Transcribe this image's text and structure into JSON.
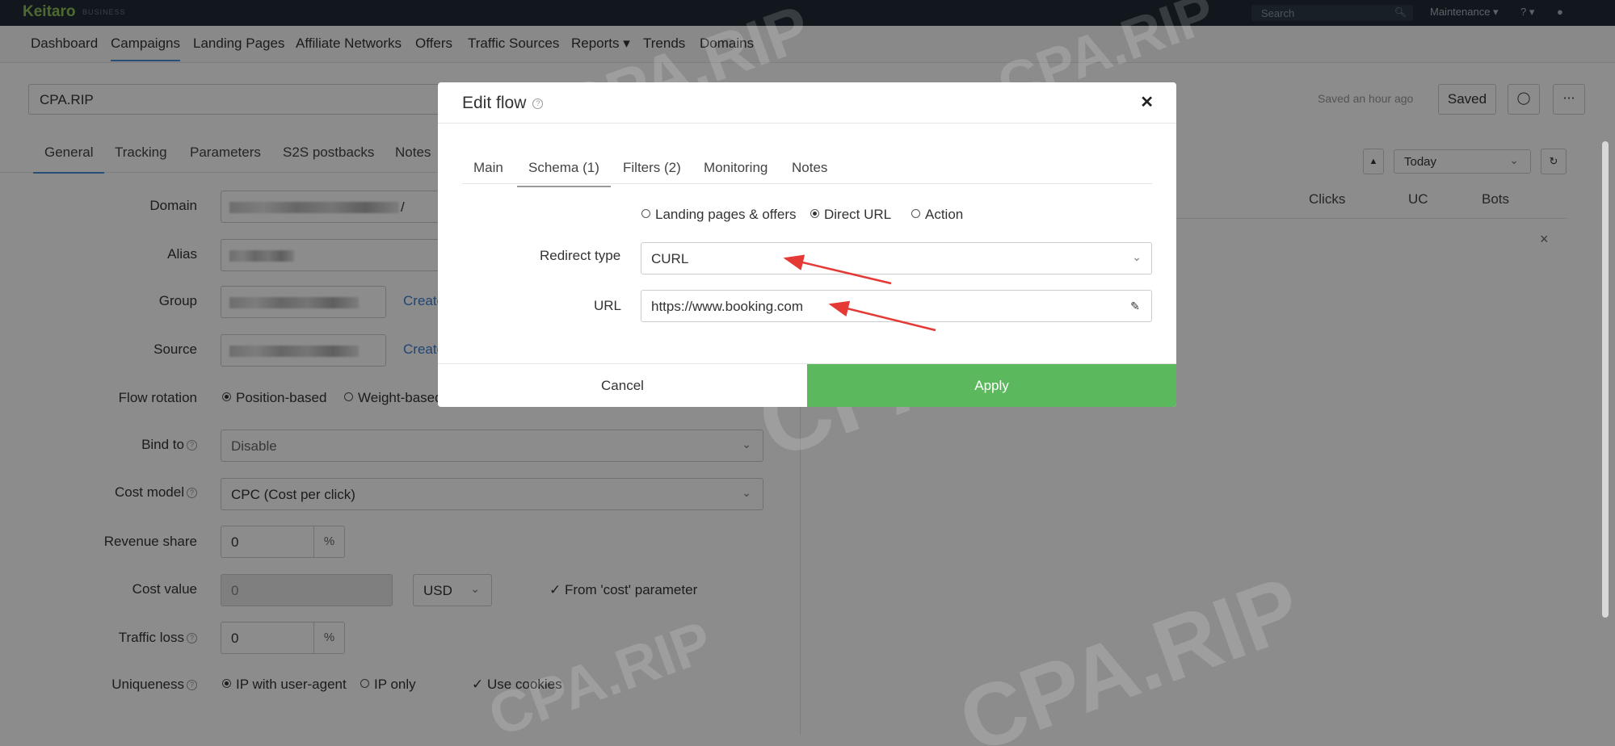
{
  "topbar": {
    "brand": "Keitaro",
    "brand_sub": "BUSINESS",
    "search_placeholder": "Search",
    "maintenance": "Maintenance ▾",
    "help": "? ▾",
    "user": "👤"
  },
  "nav": [
    "Dashboard",
    "Campaigns",
    "Landing Pages",
    "Affiliate Networks",
    "Offers",
    "Traffic Sources",
    "Reports ▾",
    "Trends",
    "Domains"
  ],
  "campaign": {
    "name": "CPA.RIP",
    "saved_ago": "Saved an hour ago",
    "saved_label": "Saved"
  },
  "subtabs": [
    "General",
    "Tracking",
    "Parameters",
    "S2S postbacks",
    "Notes"
  ],
  "form": {
    "domain_label": "Domain",
    "domain_suffix": "/",
    "alias_label": "Alias",
    "group_label": "Group",
    "group_create": "Create",
    "source_label": "Source",
    "source_create": "Create",
    "flow_rotation_label": "Flow rotation",
    "flow_rotation_opt1": "Position-based",
    "flow_rotation_opt2": "Weight-based",
    "bind_to_label": "Bind to",
    "bind_to_value": "Disable",
    "cost_model_label": "Cost model",
    "cost_model_value": "CPC (Cost per click)",
    "revenue_share_label": "Revenue share",
    "revenue_share_value": "0",
    "percent": "%",
    "cost_value_label": "Cost value",
    "cost_value_value": "0",
    "currency": "USD",
    "from_cost_param": "From 'cost' parameter",
    "traffic_loss_label": "Traffic loss",
    "traffic_loss_value": "0",
    "uniqueness_label": "Uniqueness",
    "uniq_opt1": "IP with user-agent",
    "uniq_opt2": "IP only",
    "use_cookies": "Use cookies"
  },
  "right_panel": {
    "period": "Today",
    "col_clicks": "Clicks",
    "col_uc": "UC",
    "col_bots": "Bots"
  },
  "modal": {
    "title": "Edit flow",
    "tabs": [
      "Main",
      "Schema (1)",
      "Filters (2)",
      "Monitoring",
      "Notes"
    ],
    "schema_opts": [
      "Landing pages & offers",
      "Direct URL",
      "Action"
    ],
    "redirect_type_label": "Redirect type",
    "redirect_type_value": "CURL",
    "url_label": "URL",
    "url_value": "https://www.booking.com",
    "cancel": "Cancel",
    "apply": "Apply"
  },
  "watermark": "CPA.RIP",
  "colors": {
    "apply": "#5cb85c",
    "link": "#3c7fd2",
    "brand": "#8fc25a",
    "arrow": "#e53935"
  }
}
